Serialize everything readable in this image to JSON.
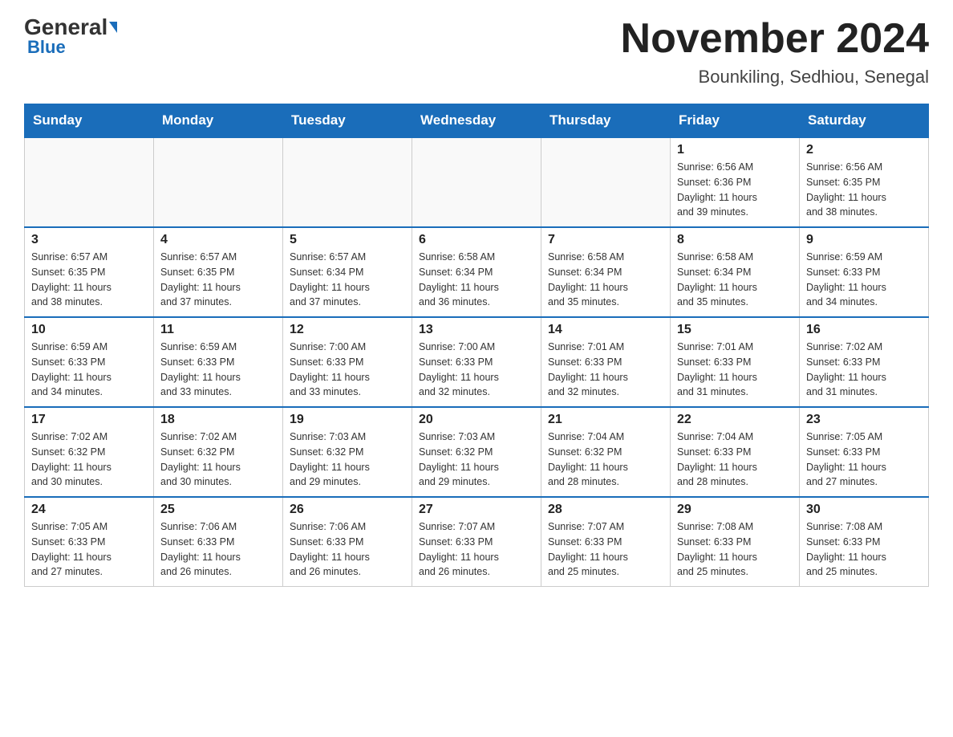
{
  "header": {
    "logo_general": "General",
    "logo_blue": "Blue",
    "month_title": "November 2024",
    "location": "Bounkiling, Sedhiou, Senegal"
  },
  "weekdays": [
    "Sunday",
    "Monday",
    "Tuesday",
    "Wednesday",
    "Thursday",
    "Friday",
    "Saturday"
  ],
  "weeks": [
    [
      {
        "day": "",
        "info": ""
      },
      {
        "day": "",
        "info": ""
      },
      {
        "day": "",
        "info": ""
      },
      {
        "day": "",
        "info": ""
      },
      {
        "day": "",
        "info": ""
      },
      {
        "day": "1",
        "info": "Sunrise: 6:56 AM\nSunset: 6:36 PM\nDaylight: 11 hours\nand 39 minutes."
      },
      {
        "day": "2",
        "info": "Sunrise: 6:56 AM\nSunset: 6:35 PM\nDaylight: 11 hours\nand 38 minutes."
      }
    ],
    [
      {
        "day": "3",
        "info": "Sunrise: 6:57 AM\nSunset: 6:35 PM\nDaylight: 11 hours\nand 38 minutes."
      },
      {
        "day": "4",
        "info": "Sunrise: 6:57 AM\nSunset: 6:35 PM\nDaylight: 11 hours\nand 37 minutes."
      },
      {
        "day": "5",
        "info": "Sunrise: 6:57 AM\nSunset: 6:34 PM\nDaylight: 11 hours\nand 37 minutes."
      },
      {
        "day": "6",
        "info": "Sunrise: 6:58 AM\nSunset: 6:34 PM\nDaylight: 11 hours\nand 36 minutes."
      },
      {
        "day": "7",
        "info": "Sunrise: 6:58 AM\nSunset: 6:34 PM\nDaylight: 11 hours\nand 35 minutes."
      },
      {
        "day": "8",
        "info": "Sunrise: 6:58 AM\nSunset: 6:34 PM\nDaylight: 11 hours\nand 35 minutes."
      },
      {
        "day": "9",
        "info": "Sunrise: 6:59 AM\nSunset: 6:33 PM\nDaylight: 11 hours\nand 34 minutes."
      }
    ],
    [
      {
        "day": "10",
        "info": "Sunrise: 6:59 AM\nSunset: 6:33 PM\nDaylight: 11 hours\nand 34 minutes."
      },
      {
        "day": "11",
        "info": "Sunrise: 6:59 AM\nSunset: 6:33 PM\nDaylight: 11 hours\nand 33 minutes."
      },
      {
        "day": "12",
        "info": "Sunrise: 7:00 AM\nSunset: 6:33 PM\nDaylight: 11 hours\nand 33 minutes."
      },
      {
        "day": "13",
        "info": "Sunrise: 7:00 AM\nSunset: 6:33 PM\nDaylight: 11 hours\nand 32 minutes."
      },
      {
        "day": "14",
        "info": "Sunrise: 7:01 AM\nSunset: 6:33 PM\nDaylight: 11 hours\nand 32 minutes."
      },
      {
        "day": "15",
        "info": "Sunrise: 7:01 AM\nSunset: 6:33 PM\nDaylight: 11 hours\nand 31 minutes."
      },
      {
        "day": "16",
        "info": "Sunrise: 7:02 AM\nSunset: 6:33 PM\nDaylight: 11 hours\nand 31 minutes."
      }
    ],
    [
      {
        "day": "17",
        "info": "Sunrise: 7:02 AM\nSunset: 6:32 PM\nDaylight: 11 hours\nand 30 minutes."
      },
      {
        "day": "18",
        "info": "Sunrise: 7:02 AM\nSunset: 6:32 PM\nDaylight: 11 hours\nand 30 minutes."
      },
      {
        "day": "19",
        "info": "Sunrise: 7:03 AM\nSunset: 6:32 PM\nDaylight: 11 hours\nand 29 minutes."
      },
      {
        "day": "20",
        "info": "Sunrise: 7:03 AM\nSunset: 6:32 PM\nDaylight: 11 hours\nand 29 minutes."
      },
      {
        "day": "21",
        "info": "Sunrise: 7:04 AM\nSunset: 6:32 PM\nDaylight: 11 hours\nand 28 minutes."
      },
      {
        "day": "22",
        "info": "Sunrise: 7:04 AM\nSunset: 6:33 PM\nDaylight: 11 hours\nand 28 minutes."
      },
      {
        "day": "23",
        "info": "Sunrise: 7:05 AM\nSunset: 6:33 PM\nDaylight: 11 hours\nand 27 minutes."
      }
    ],
    [
      {
        "day": "24",
        "info": "Sunrise: 7:05 AM\nSunset: 6:33 PM\nDaylight: 11 hours\nand 27 minutes."
      },
      {
        "day": "25",
        "info": "Sunrise: 7:06 AM\nSunset: 6:33 PM\nDaylight: 11 hours\nand 26 minutes."
      },
      {
        "day": "26",
        "info": "Sunrise: 7:06 AM\nSunset: 6:33 PM\nDaylight: 11 hours\nand 26 minutes."
      },
      {
        "day": "27",
        "info": "Sunrise: 7:07 AM\nSunset: 6:33 PM\nDaylight: 11 hours\nand 26 minutes."
      },
      {
        "day": "28",
        "info": "Sunrise: 7:07 AM\nSunset: 6:33 PM\nDaylight: 11 hours\nand 25 minutes."
      },
      {
        "day": "29",
        "info": "Sunrise: 7:08 AM\nSunset: 6:33 PM\nDaylight: 11 hours\nand 25 minutes."
      },
      {
        "day": "30",
        "info": "Sunrise: 7:08 AM\nSunset: 6:33 PM\nDaylight: 11 hours\nand 25 minutes."
      }
    ]
  ]
}
